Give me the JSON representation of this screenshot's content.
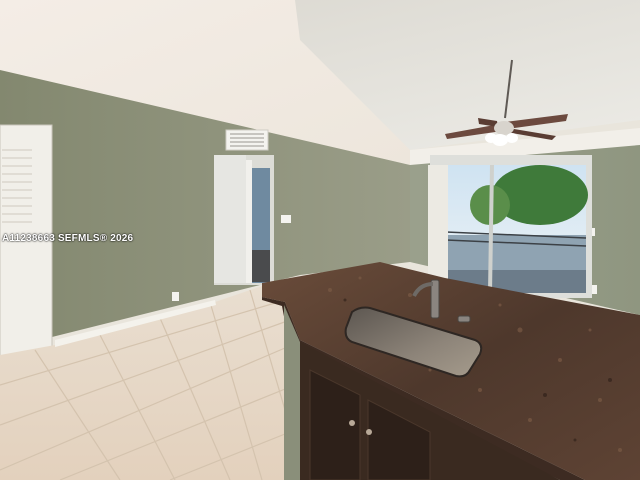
{
  "photo": {
    "scene": "kitchen-living-room-interior",
    "watermark_text": "A11238663 SEFMLS® 2026"
  },
  "colors": {
    "ceiling": "#e3e0d8",
    "wall": "#8d927c",
    "floor_tile": "#e7d9c7",
    "granite": "#5a4033",
    "cabinet": "#3a2a20",
    "sink": "#8c8478"
  }
}
